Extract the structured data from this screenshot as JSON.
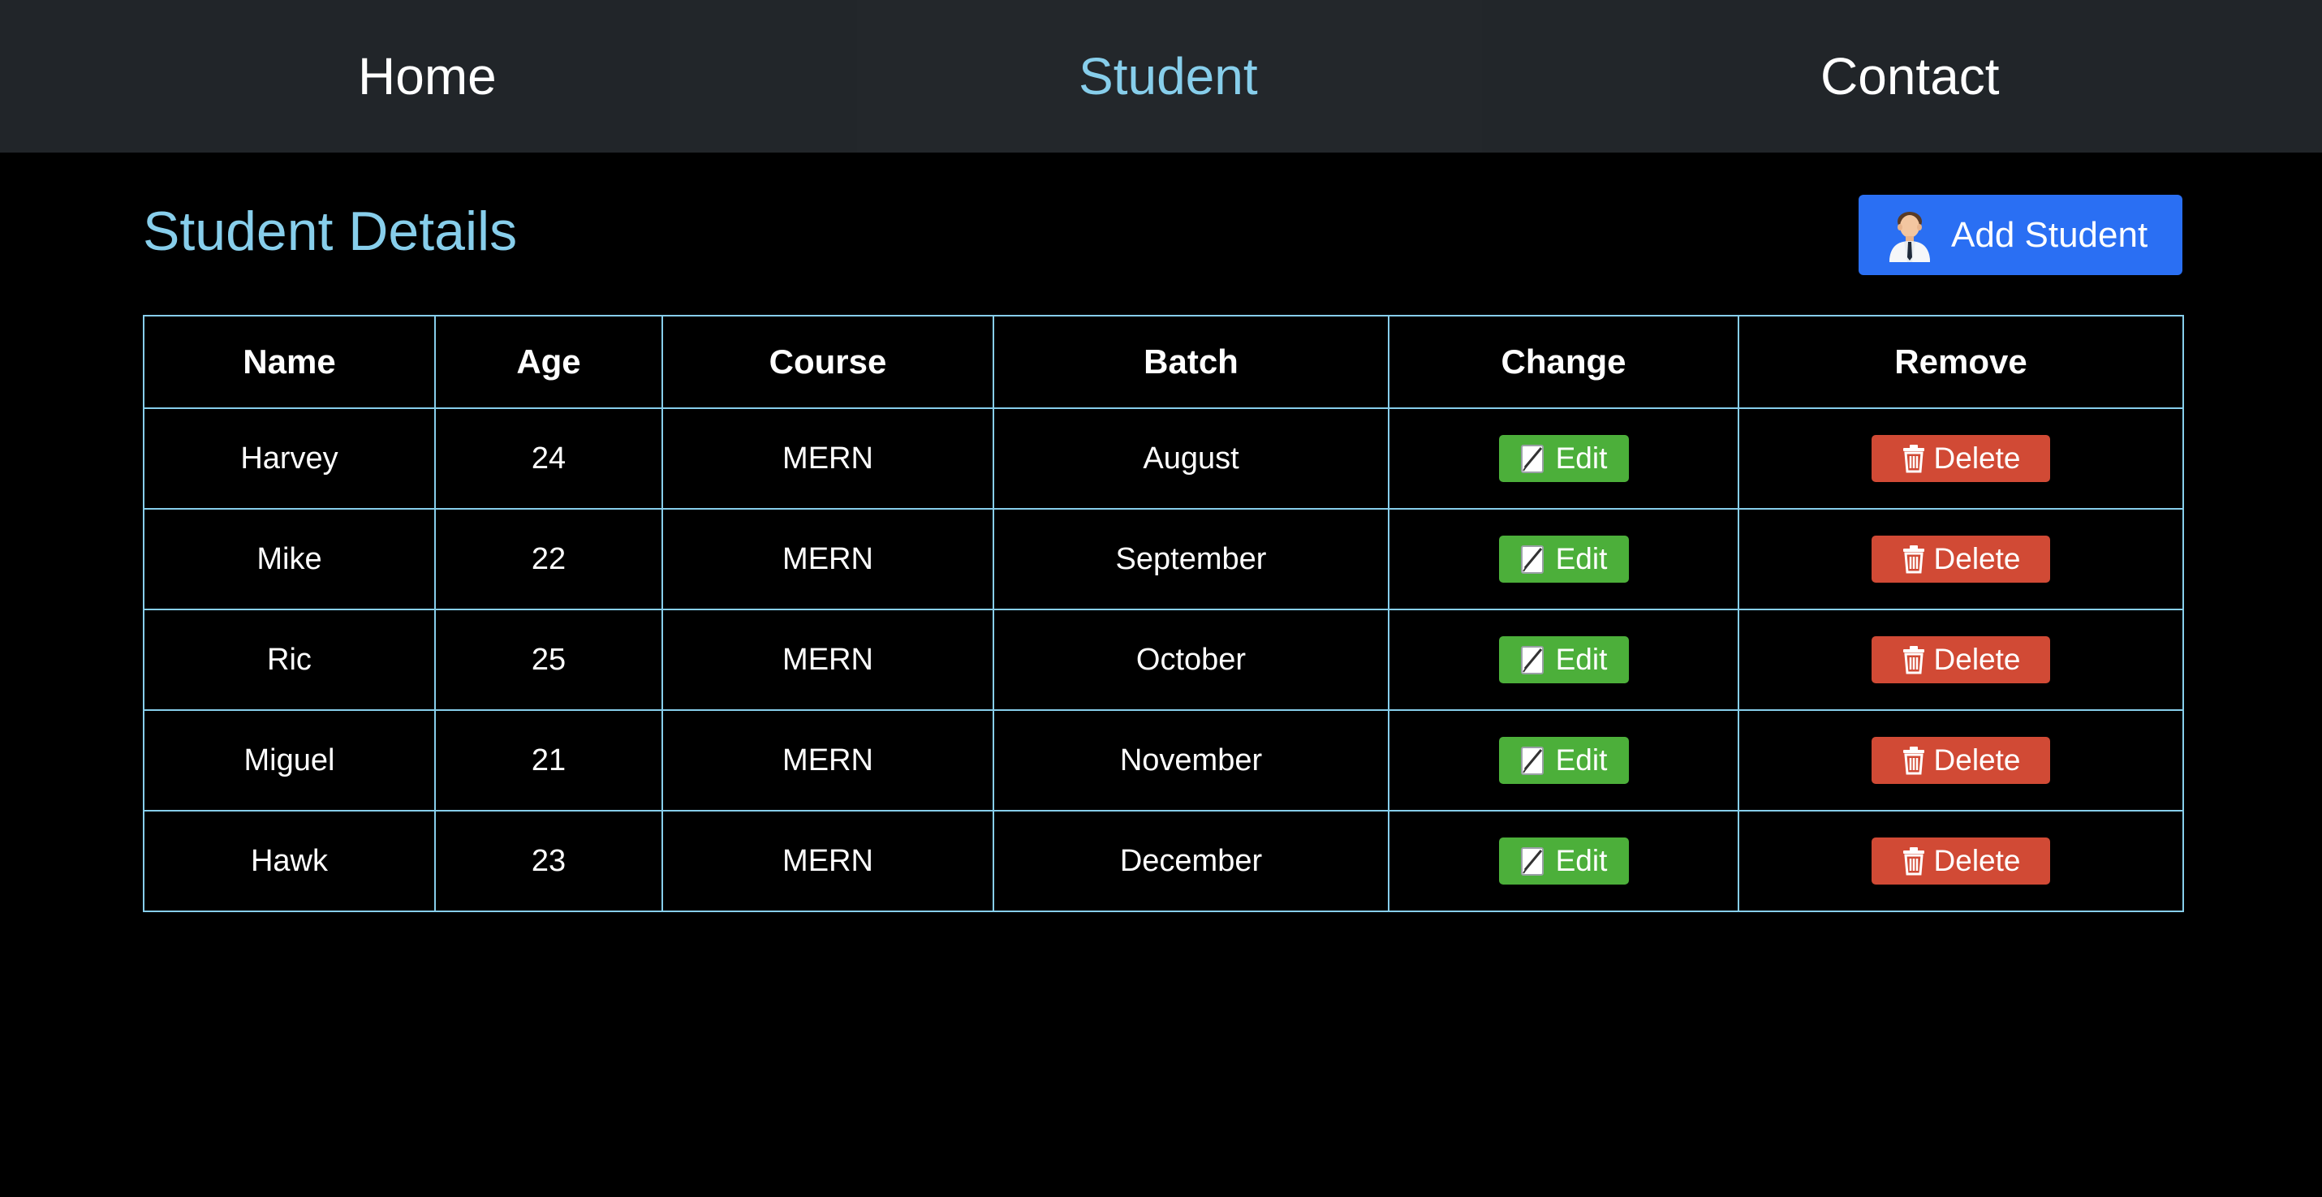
{
  "nav": {
    "items": [
      {
        "label": "Home"
      },
      {
        "label": "Student"
      },
      {
        "label": "Contact"
      }
    ],
    "active": "Student"
  },
  "header": {
    "title": "Student Details",
    "add_button_label": "Add Student",
    "add_button_icon": "person-icon"
  },
  "table": {
    "columns": [
      "Name",
      "Age",
      "Course",
      "Batch",
      "Change",
      "Remove"
    ],
    "rows": [
      {
        "name": "Harvey",
        "age": "24",
        "course": "MERN",
        "batch": "August",
        "edit": "Edit",
        "delete": "Delete"
      },
      {
        "name": "Mike",
        "age": "22",
        "course": "MERN",
        "batch": "September",
        "edit": "Edit",
        "delete": "Delete"
      },
      {
        "name": "Ric",
        "age": "25",
        "course": "MERN",
        "batch": "October",
        "edit": "Edit",
        "delete": "Delete"
      },
      {
        "name": "Miguel",
        "age": "21",
        "course": "MERN",
        "batch": "November",
        "edit": "Edit",
        "delete": "Delete"
      },
      {
        "name": "Hawk",
        "age": "23",
        "course": "MERN",
        "batch": "December",
        "edit": "Edit",
        "delete": "Delete"
      }
    ]
  },
  "icons": {
    "edit": "edit-note-icon",
    "delete": "trash-icon"
  },
  "colors": {
    "nav_bg": "#212529",
    "accent": "#87ceeb",
    "primary": "#2a6ff3",
    "edit": "#4caf3a",
    "delete": "#d14a35",
    "background": "#000000"
  }
}
